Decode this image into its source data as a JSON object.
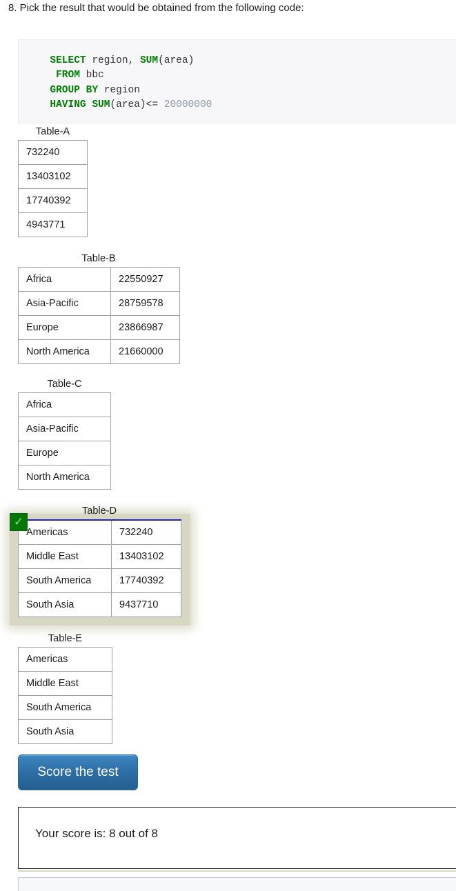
{
  "question": {
    "number": "8.",
    "text": "8. Pick the result that would be obtained from the following code:"
  },
  "code": {
    "language": "sql",
    "lines": [
      {
        "indent": 2,
        "tokens": [
          {
            "t": "SELECT",
            "k": "kw"
          },
          {
            "t": " region, ",
            "k": "plain"
          },
          {
            "t": "SUM",
            "k": "kw"
          },
          {
            "t": "(area)",
            "k": "plain"
          }
        ]
      },
      {
        "indent": 3,
        "tokens": [
          {
            "t": "FROM",
            "k": "kw"
          },
          {
            "t": " bbc",
            "k": "plain"
          }
        ]
      },
      {
        "indent": 2,
        "tokens": [
          {
            "t": "GROUP BY",
            "k": "kw"
          },
          {
            "t": " region",
            "k": "plain"
          }
        ]
      },
      {
        "indent": 2,
        "tokens": [
          {
            "t": "HAVING SUM",
            "k": "kw"
          },
          {
            "t": "(area)<= ",
            "k": "plain"
          },
          {
            "t": "20000000",
            "k": "num"
          }
        ]
      }
    ],
    "plain_text": "  SELECT region, SUM(area)\n    FROM bbc\n  GROUP BY region\n  HAVING SUM(area)<= 20000000"
  },
  "options": [
    {
      "id": "a",
      "label": "Table-A",
      "columns": 1,
      "selected": false,
      "rows": [
        [
          "732240"
        ],
        [
          "13403102"
        ],
        [
          "17740392"
        ],
        [
          "4943771"
        ]
      ]
    },
    {
      "id": "b",
      "label": "Table-B",
      "columns": 2,
      "selected": false,
      "rows": [
        [
          "Africa",
          "22550927"
        ],
        [
          "Asia-Pacific",
          "28759578"
        ],
        [
          "Europe",
          "23866987"
        ],
        [
          "North America",
          "21660000"
        ]
      ]
    },
    {
      "id": "c",
      "label": "Table-C",
      "columns": 1,
      "selected": false,
      "rows": [
        [
          "Africa"
        ],
        [
          "Asia-Pacific"
        ],
        [
          "Europe"
        ],
        [
          "North America"
        ]
      ]
    },
    {
      "id": "d",
      "label": "Table-D",
      "columns": 2,
      "selected": true,
      "check_glyph": "✓",
      "rows": [
        [
          "Americas",
          "732240"
        ],
        [
          "Middle East",
          "13403102"
        ],
        [
          "South America",
          "17740392"
        ],
        [
          "South Asia",
          "9437710"
        ]
      ]
    },
    {
      "id": "e",
      "label": "Table-E",
      "columns": 1,
      "selected": false,
      "rows": [
        [
          "Americas"
        ],
        [
          "Middle East"
        ],
        [
          "South America"
        ],
        [
          "South Asia"
        ]
      ]
    }
  ],
  "actions": {
    "score_button_label": "Score the test"
  },
  "result": {
    "score_text": "Your score is: 8 out of 8",
    "score_value": 8,
    "score_total": 8
  },
  "colors": {
    "sql_keyword": "#008000",
    "sql_number": "#8e9aaa",
    "code_background": "#f7f7f9",
    "selected_highlight": "#d7d7c4",
    "check_badge": "#067706",
    "selected_table_top_border": "#2222cc",
    "button_blue": "#2d6ea4"
  }
}
